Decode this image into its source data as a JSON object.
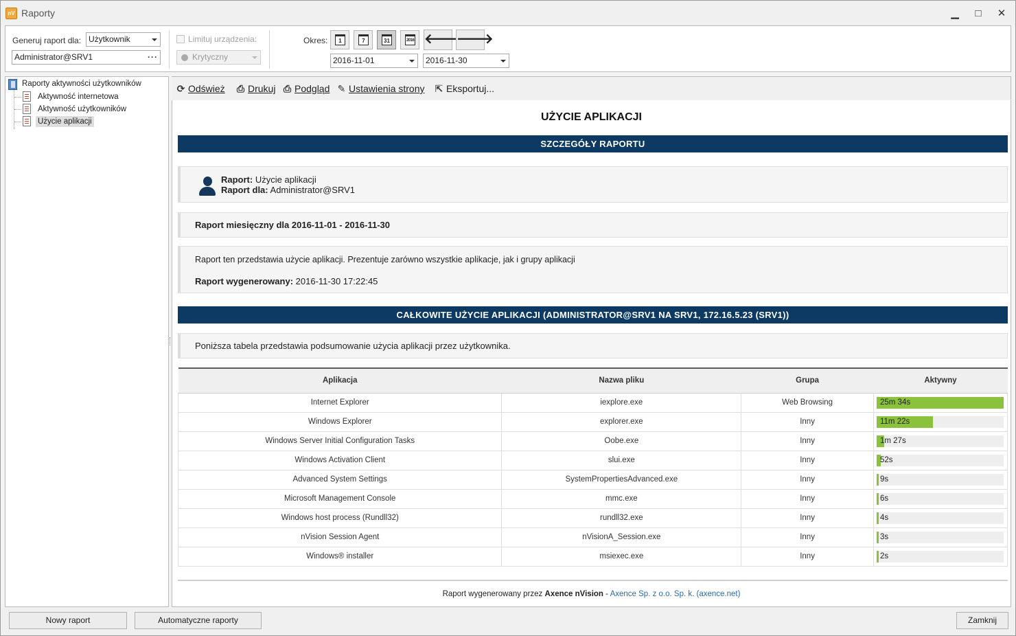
{
  "window": {
    "title": "Raporty",
    "icon_text": "nV",
    "minimize_label": "▁",
    "maximize_label": "□",
    "close_label": "✕"
  },
  "filters": {
    "generate_for_label": "Generuj raport dla:",
    "generate_for_value": "Użytkownik",
    "user_value": "Administrator@SRV1",
    "user_more": "···",
    "limit_devices_label": "Limituj urządzenia:",
    "criticality_value": "Krytyczny",
    "period_label": "Okres:",
    "period_buttons": [
      "1",
      "7",
      "31",
      "2016"
    ],
    "date_from": "2016-11-01",
    "date_to": "2016-11-30",
    "prev_arrow": "🡐",
    "next_arrow": "🡒"
  },
  "tree": {
    "root": "Raporty aktywności użytkowników",
    "items": [
      {
        "label": "Aktywność internetowa",
        "selected": false
      },
      {
        "label": "Aktywność użytkowników",
        "selected": false
      },
      {
        "label": "Użycie aplikacji",
        "selected": true
      }
    ]
  },
  "toolbar": {
    "refresh": "Odśwież",
    "print": "Drukuj",
    "preview": "Podgląd",
    "page_setup": "Ustawienia strony",
    "export": "Eksportuj..."
  },
  "report": {
    "title": "UŻYCIE APLIKACJI",
    "details_band": "SZCZEGÓŁY RAPORTU",
    "report_label": "Raport:",
    "report_value": "Użycie aplikacji",
    "report_for_label": "Raport dla:",
    "report_for_value": "Administrator@SRV1",
    "monthly": "Raport miesięczny dla 2016-11-01 - 2016-11-30",
    "description": "Raport ten przedstawia użycie aplikacji. Prezentuje zarówno wszystkie aplikacje, jak i grupy aplikacji",
    "generated_label": "Raport wygenerowany:",
    "generated_value": "2016-11-30 17:22:45",
    "total_band": "CAŁKOWITE UŻYCIE APLIKACJI (ADMINISTRATOR@SRV1 NA SRV1, 172.16.5.23 (SRV1))",
    "table_intro": "Poniższa tabela przedstawia podsumowanie użycia aplikacji przez użytkownika.",
    "columns": [
      "Aplikacja",
      "Nazwa pliku",
      "Grupa",
      "Aktywny"
    ],
    "rows": [
      {
        "app": "Internet Explorer",
        "file": "iexplore.exe",
        "group": "Web Browsing",
        "active": "25m 34s",
        "fraction": 1.0
      },
      {
        "app": "Windows Explorer",
        "file": "explorer.exe",
        "group": "Inny",
        "active": "11m 22s",
        "fraction": 0.445
      },
      {
        "app": "Windows Server Initial Configuration Tasks",
        "file": "Oobe.exe",
        "group": "Inny",
        "active": "1m 27s",
        "fraction": 0.057
      },
      {
        "app": "Windows Activation Client",
        "file": "slui.exe",
        "group": "Inny",
        "active": "52s",
        "fraction": 0.034
      },
      {
        "app": "Advanced System Settings",
        "file": "SystemPropertiesAdvanced.exe",
        "group": "Inny",
        "active": "9s",
        "fraction": 0.006
      },
      {
        "app": "Microsoft Management Console",
        "file": "mmc.exe",
        "group": "Inny",
        "active": "6s",
        "fraction": 0.004
      },
      {
        "app": "Windows host process (Rundll32)",
        "file": "rundll32.exe",
        "group": "Inny",
        "active": "4s",
        "fraction": 0.003
      },
      {
        "app": "nVision Session Agent",
        "file": "nVisionA_Session.exe",
        "group": "Inny",
        "active": "3s",
        "fraction": 0.002
      },
      {
        "app": "Windows® installer",
        "file": "msiexec.exe",
        "group": "Inny",
        "active": "2s",
        "fraction": 0.001
      }
    ],
    "footer_prefix": "Raport wygenerowany przez",
    "footer_brand": "Axence nVision",
    "footer_dash": "-",
    "footer_link": "Axence Sp. z o.o. Sp. k. (axence.net)"
  },
  "bottom": {
    "new_report": "Nowy raport",
    "auto_reports": "Automatyczne raporty",
    "close": "Zamknij"
  },
  "colors": {
    "band": "#0c3a63",
    "bar": "#8ac23b",
    "link": "#2a6aa9"
  }
}
